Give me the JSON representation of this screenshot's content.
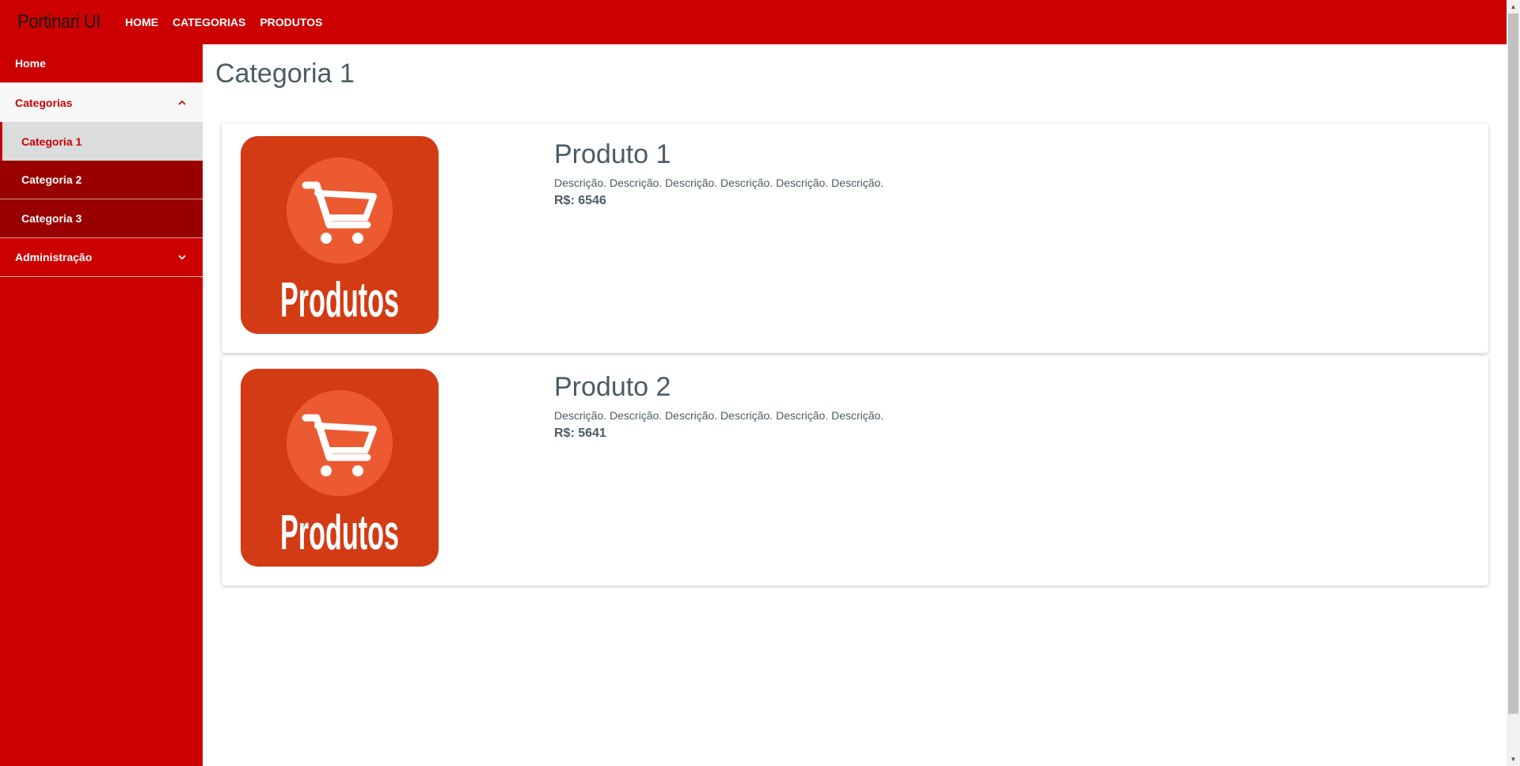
{
  "toolbar": {
    "brand": "Portinari UI",
    "nav": [
      "HOME",
      "CATEGORIAS",
      "PRODUTOS"
    ]
  },
  "sidebar": {
    "items": [
      {
        "label": "Home"
      },
      {
        "label": "Categorias",
        "expanded": true,
        "children": [
          {
            "label": "Categoria 1",
            "active": true
          },
          {
            "label": "Categoria 2"
          },
          {
            "label": "Categoria 3"
          }
        ]
      },
      {
        "label": "Administração",
        "expanded": false
      }
    ]
  },
  "main": {
    "title": "Categoria 1",
    "products": [
      {
        "image_text": "Produtos",
        "title": "Produto 1",
        "description": "Descrição. Descrição. Descrição. Descrição. Descrição. Descrição.",
        "price": "R$: 6546"
      },
      {
        "image_text": "Produtos",
        "title": "Produto 2",
        "description": "Descrição. Descrição. Descrição. Descrição. Descrição. Descrição.",
        "price": "R$: 5641"
      }
    ]
  },
  "colors": {
    "primary": "#cc0000",
    "primary_dark": "#990000",
    "product_image_bg": "#d33b14",
    "product_image_circle": "#ec5a32"
  },
  "icons": [
    "chevron-up-icon",
    "chevron-down-icon",
    "shopping-cart-icon"
  ]
}
